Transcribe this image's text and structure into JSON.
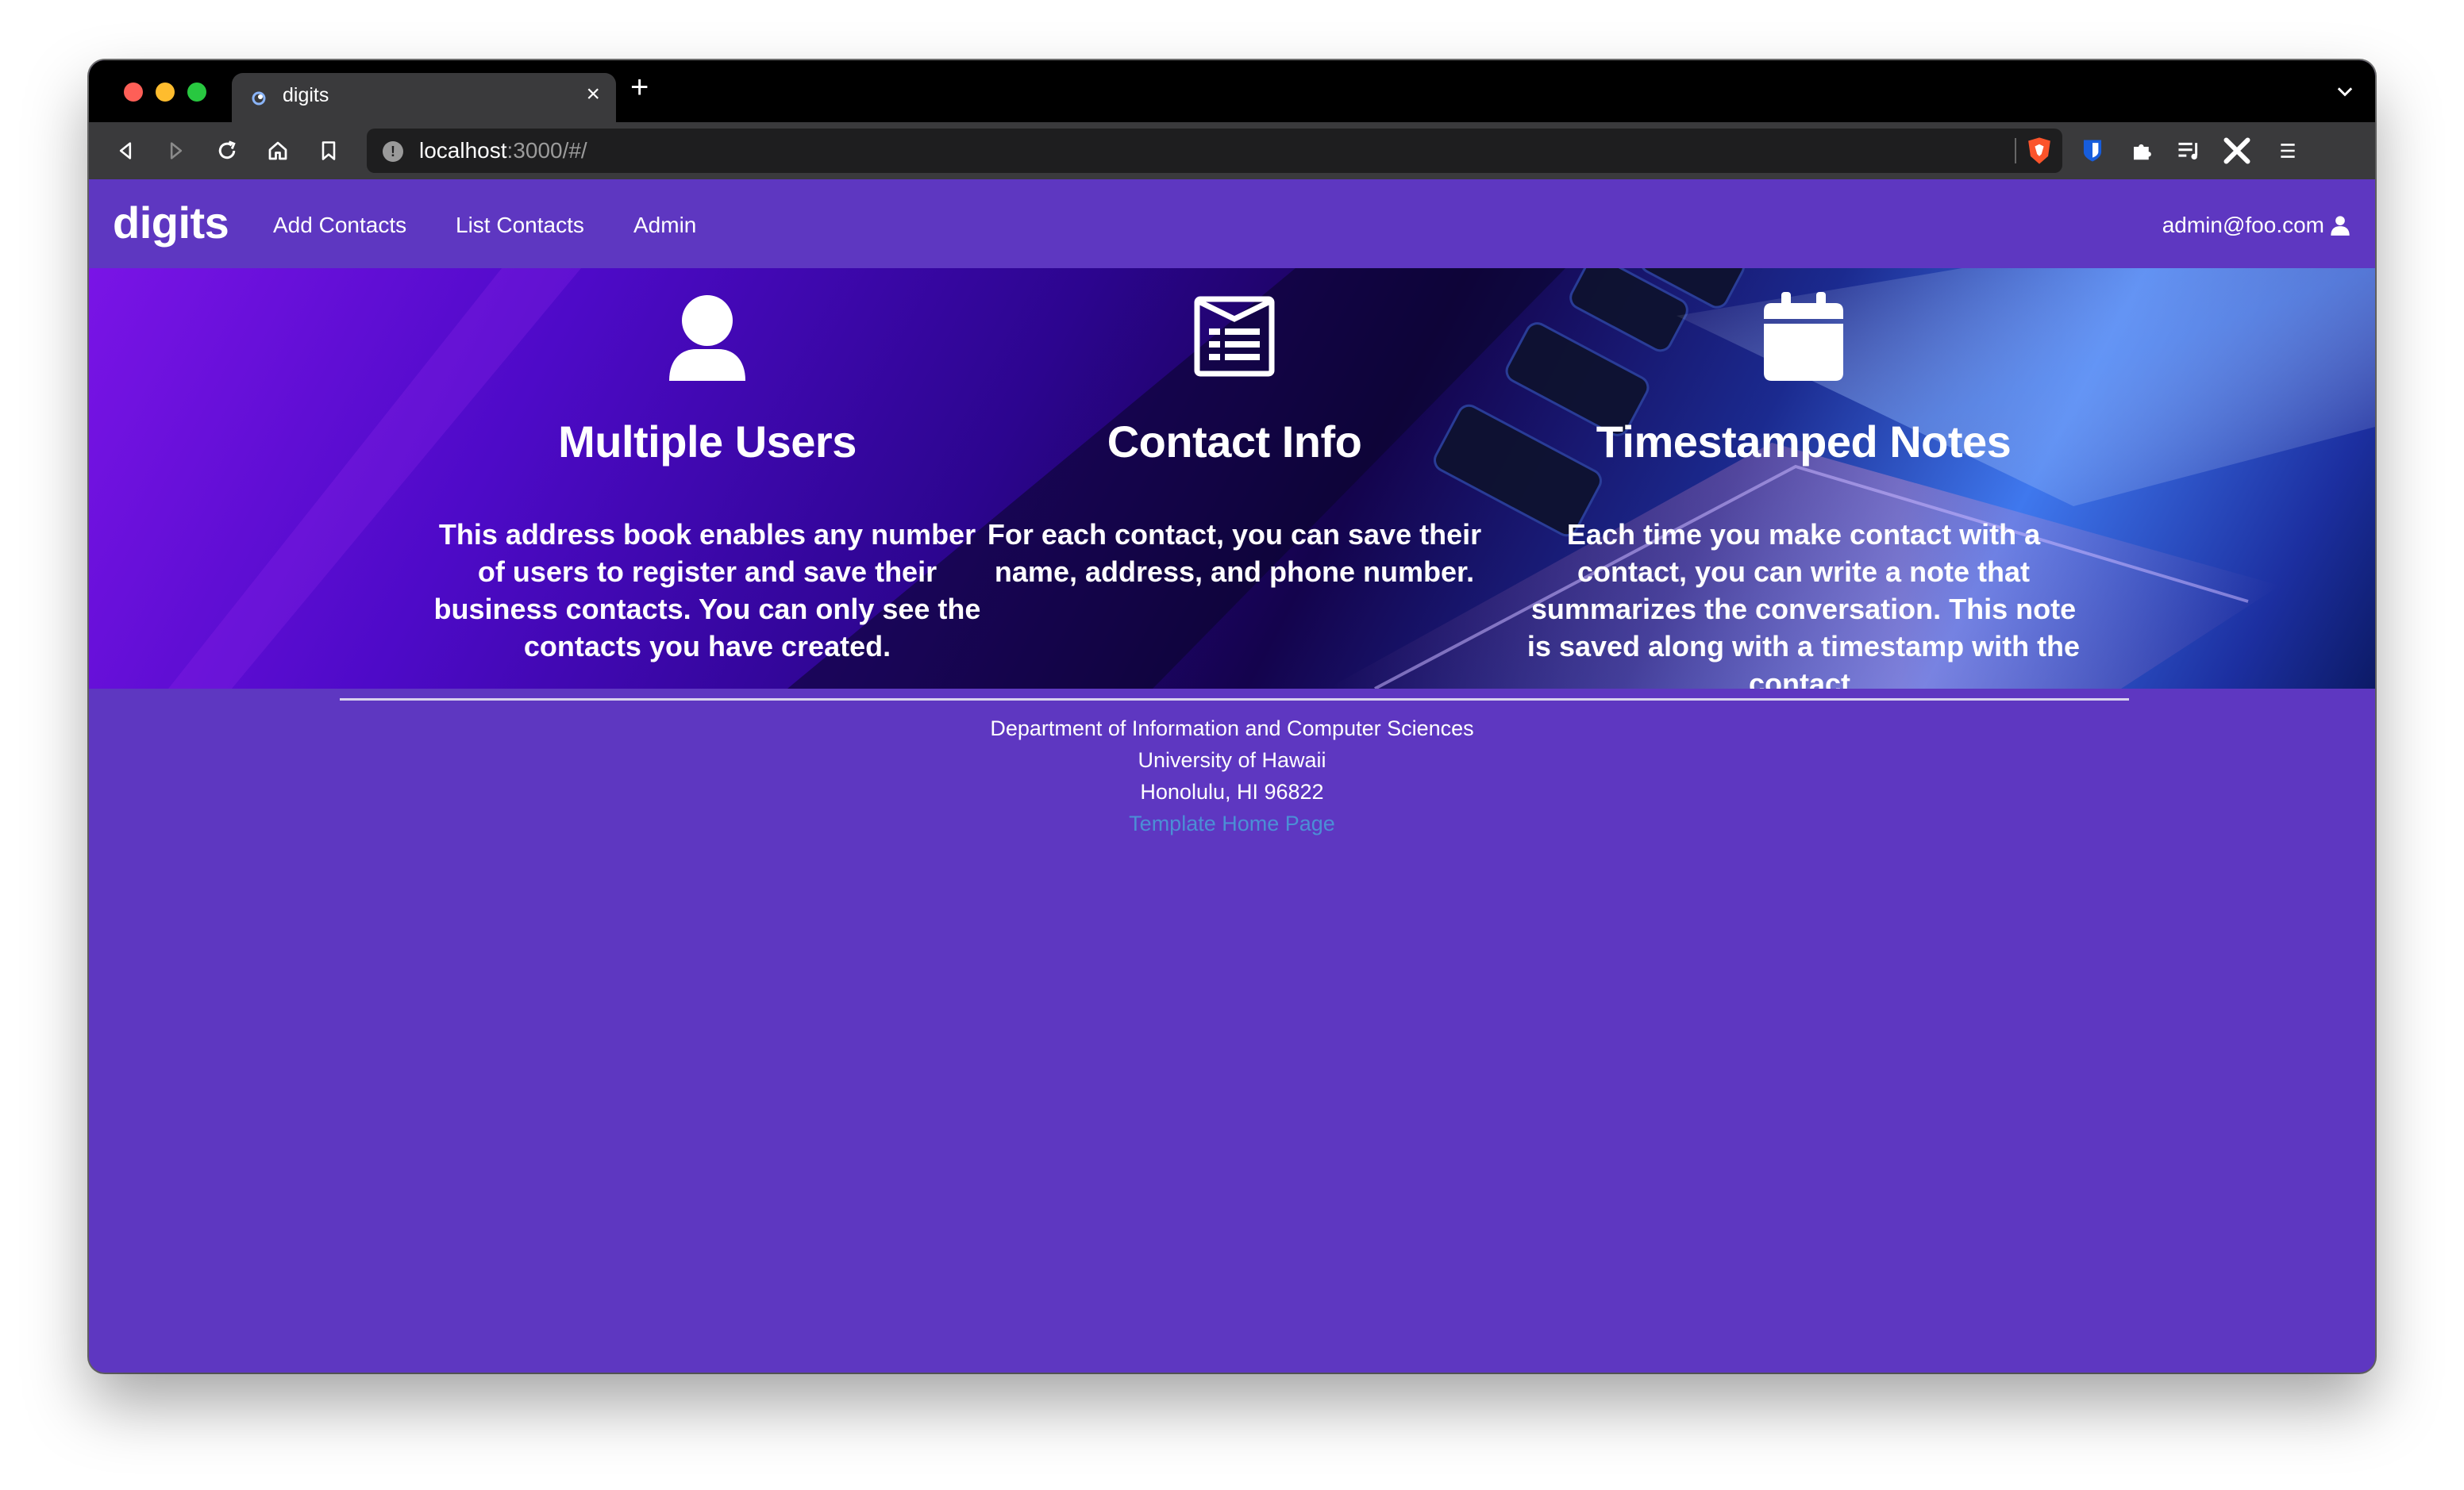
{
  "browser": {
    "tab_title": "digits",
    "url_host": "localhost",
    "url_path": ":3000/#/"
  },
  "navbar": {
    "brand": "digits",
    "links": [
      "Add Contacts",
      "List Contacts",
      "Admin"
    ],
    "user_email": "admin@foo.com"
  },
  "features": [
    {
      "icon": "user-icon",
      "title": "Multiple Users",
      "description": "This address book enables any number of users to register and save their business contacts. You can only see the contacts you have created."
    },
    {
      "icon": "list-alternate-icon",
      "title": "Contact Info",
      "description": "For each contact, you can save their name, address, and phone number."
    },
    {
      "icon": "calendar-icon",
      "title": "Timestamped Notes",
      "description": "Each time you make contact with a contact, you can write a note that summarizes the conversation. This note is saved along with a timestamp with the contact."
    }
  ],
  "footer": {
    "lines": [
      "Department of Information and Computer Sciences",
      "University of Hawaii",
      "Honolulu, HI 96822"
    ],
    "link_label": "Template Home Page"
  },
  "colors": {
    "brand_purple": "#5e37c1",
    "link_blue": "#4b8fd6"
  }
}
